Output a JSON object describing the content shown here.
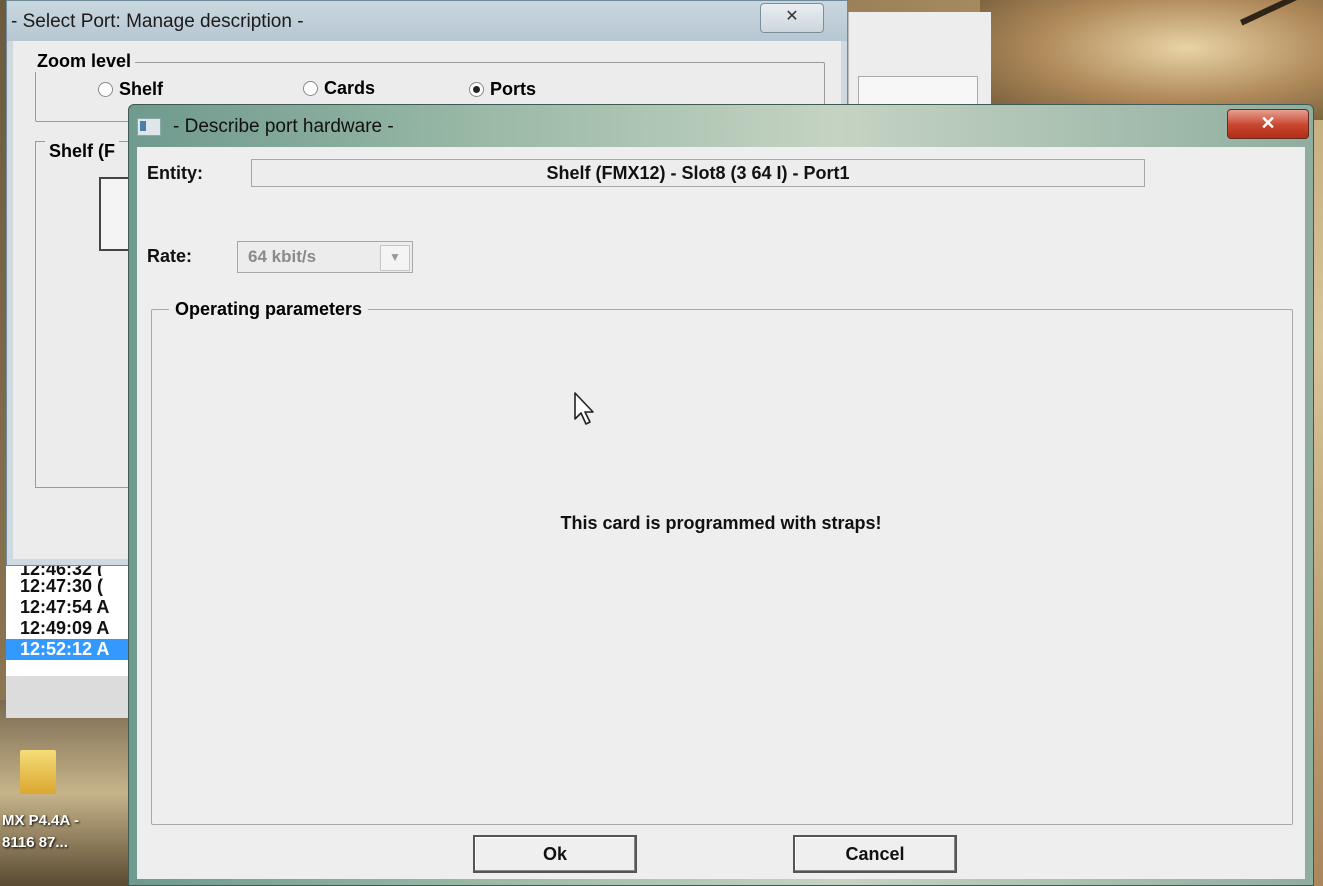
{
  "background_dialog": {
    "title": "- Select Port: Manage description -",
    "close_glyph": "✕",
    "zoom_group_label": "Zoom level",
    "zoom_options": [
      {
        "label": "Shelf",
        "selected": false
      },
      {
        "label": "Cards",
        "selected": false
      },
      {
        "label": "Ports",
        "selected": true
      }
    ],
    "shelf_group_label": "Shelf (F"
  },
  "log_list": {
    "items": [
      {
        "text": "12:46:32  (",
        "selected": false,
        "partial": true
      },
      {
        "text": "12:47:30  (",
        "selected": false
      },
      {
        "text": "12:47:54  A",
        "selected": false
      },
      {
        "text": "12:49:09  A",
        "selected": false
      },
      {
        "text": "12:52:12  A",
        "selected": true
      }
    ]
  },
  "desktop_icon": {
    "line1": "MX P4.4A -",
    "line2": "8116 87..."
  },
  "dialog": {
    "title": "- Describe port hardware -",
    "close_glyph": "✕",
    "entity_label": "Entity:",
    "entity_value": "Shelf (FMX12) - Slot8 (3 64 I) - Port1",
    "rate_label": "Rate:",
    "rate_value": "64 kbit/s",
    "operating_group_label": "Operating parameters",
    "message": "This card is programmed with straps!",
    "ok_label": "Ok",
    "cancel_label": "Cancel"
  },
  "colors": {
    "selection": "#3399ff",
    "close_button": "#c8452d",
    "dialog_bg": "#eeeeee"
  }
}
